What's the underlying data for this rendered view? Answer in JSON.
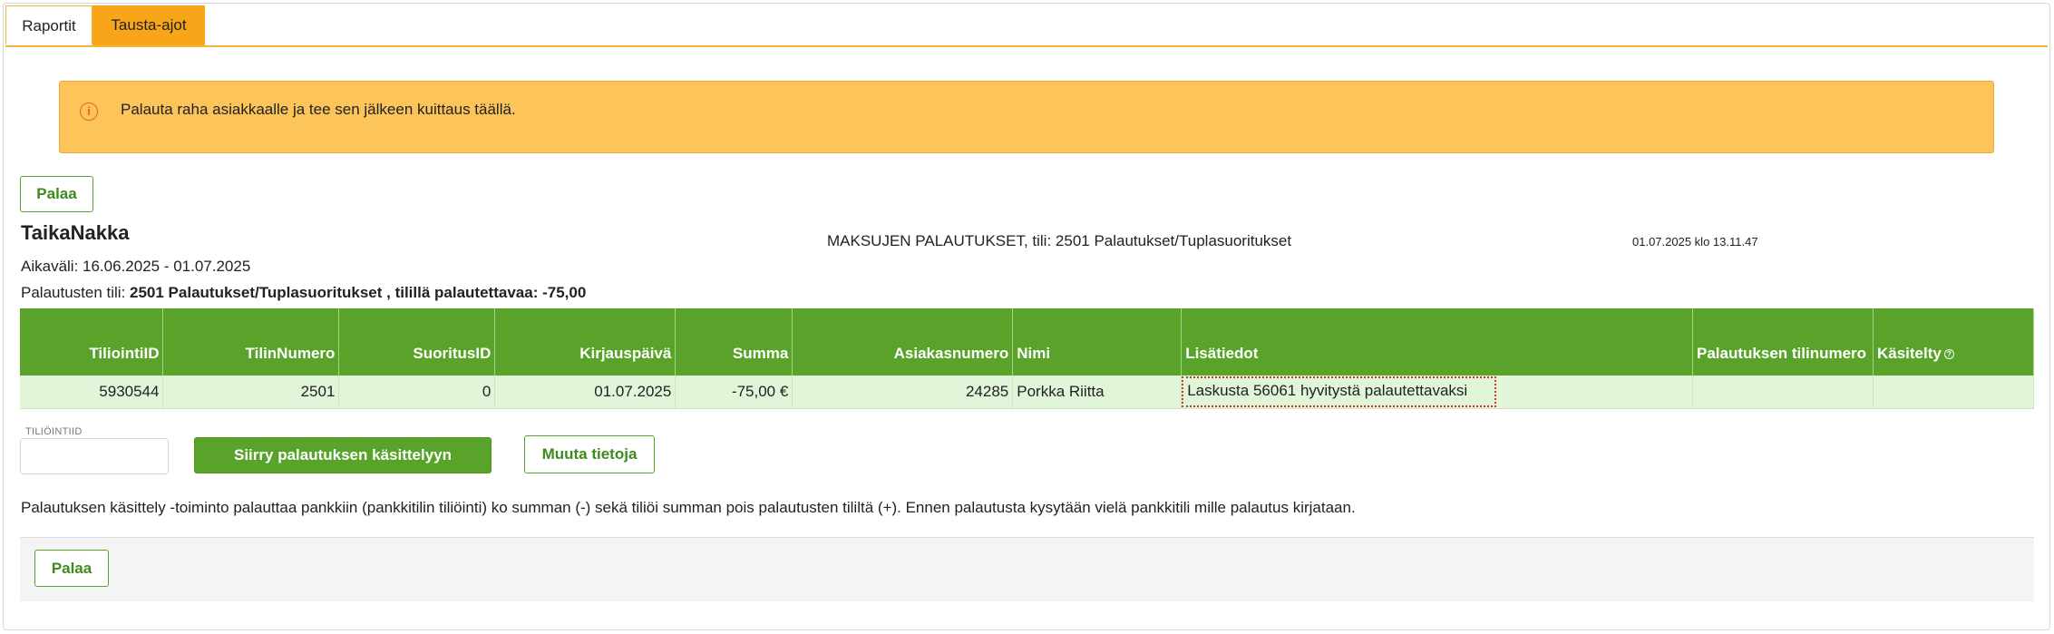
{
  "tabs": [
    {
      "label": "Raportit",
      "active": true
    },
    {
      "label": "Tausta-ajot",
      "active": false
    }
  ],
  "alert": {
    "icon": "info-circle-icon",
    "text": "Palauta raha asiakkaalle ja tee sen jälkeen kuittaus täällä."
  },
  "buttons": {
    "back_top": "Palaa",
    "back_bottom": "Palaa",
    "process": "Siirry palautuksen käsittelyyn",
    "edit": "Muuta tietoja"
  },
  "report": {
    "company": "TaikaNakka",
    "title": "MAKSUJEN PALAUTUKSET, tili: 2501 Palautukset/Tuplasuoritukset",
    "timestamp": "01.07.2025 klo 13.11.47",
    "period": "Aikaväli: 16.06.2025 - 01.07.2025",
    "account_prefix": "Palautusten tili: ",
    "account_value": "2501 Palautukset/Tuplasuoritukset , tilillä palautettavaa: -75,00"
  },
  "table": {
    "headers": {
      "tiliointiid": "TiliointiID",
      "tilinnumero": "TilinNumero",
      "suoritusid": "SuoritusID",
      "kirjauspaiva": "Kirjauspäivä",
      "summa": "Summa",
      "asiakasnumero": "Asiakasnumero",
      "nimi": "Nimi",
      "lisatiedot": "Lisätiedot",
      "palautuksen_tilinumero": "Palautuksen tilinumero",
      "kasitelty": "Käsitelty"
    },
    "rows": [
      {
        "tiliointiid": "5930544",
        "tilinnumero": "2501",
        "suoritusid": "0",
        "kirjauspaiva": "01.07.2025",
        "summa": "-75,00 €",
        "asiakasnumero": "24285",
        "nimi": "Porkka Riitta",
        "lisatiedot": "Laskusta 56061 hyvitystä palautettavaksi",
        "palautuksen_tilinumero": "",
        "kasitelty": ""
      }
    ]
  },
  "form": {
    "tiliointiid_label": "TILIÖINTIID",
    "tiliointiid_value": ""
  },
  "note": "Palautuksen käsittely -toiminto palauttaa pankkiin (pankkitilin tiliöinti) ko summan (-) sekä tiliöi summan pois palautusten tililtä (+). Ennen palautusta kysytään vielä pankkitili mille palautus kirjataan.",
  "colors": {
    "accent_green": "#5aa32b",
    "row_green": "#e1f5d9",
    "tab_orange": "#f9a51a",
    "alert_bg": "#fdc45a"
  }
}
